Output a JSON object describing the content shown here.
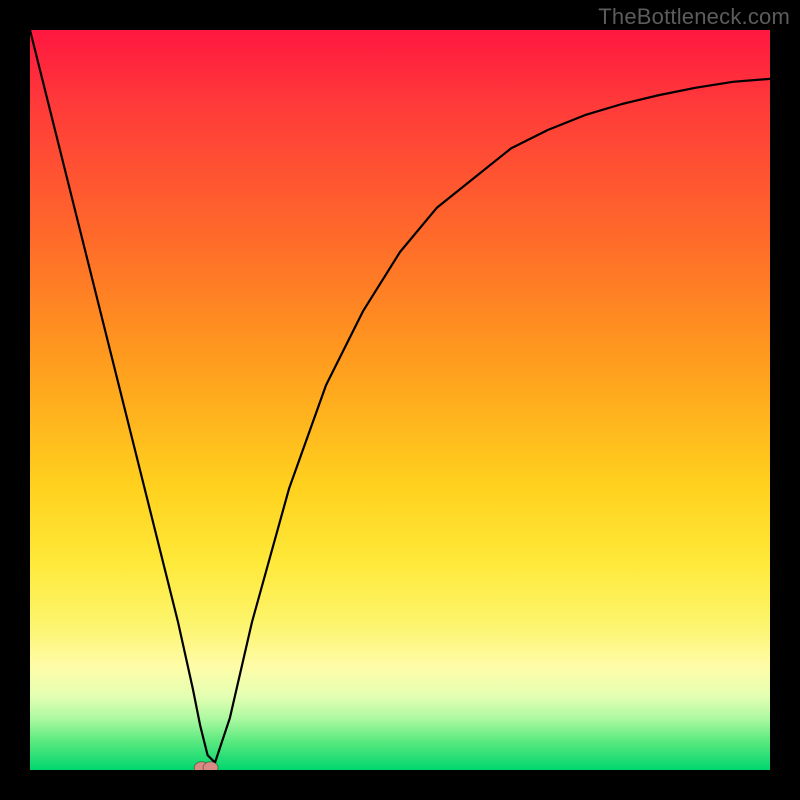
{
  "source_label": "TheBottleneck.com",
  "chart_data": {
    "type": "line",
    "title": "",
    "xlabel": "",
    "ylabel": "",
    "xlim": [
      0,
      100
    ],
    "ylim": [
      0,
      100
    ],
    "series": [
      {
        "name": "curve",
        "x": [
          0,
          3,
          6,
          9,
          12,
          15,
          18,
          20,
          22,
          23,
          24,
          25,
          27,
          30,
          35,
          40,
          45,
          50,
          55,
          60,
          65,
          70,
          75,
          80,
          85,
          90,
          95,
          100
        ],
        "values": [
          100,
          88,
          76,
          64,
          52,
          40,
          28,
          20,
          11,
          6,
          2,
          1,
          7,
          20,
          38,
          52,
          62,
          70,
          76,
          80,
          84,
          86.5,
          88.5,
          90,
          91.2,
          92.2,
          93,
          93.4
        ]
      }
    ],
    "markers": [
      {
        "name": "dot-a",
        "x": 23.2,
        "y": 0.3
      },
      {
        "name": "dot-b",
        "x": 24.4,
        "y": 0.3
      }
    ]
  },
  "colors": {
    "curve": "#000000",
    "marker": "#d88b82"
  }
}
